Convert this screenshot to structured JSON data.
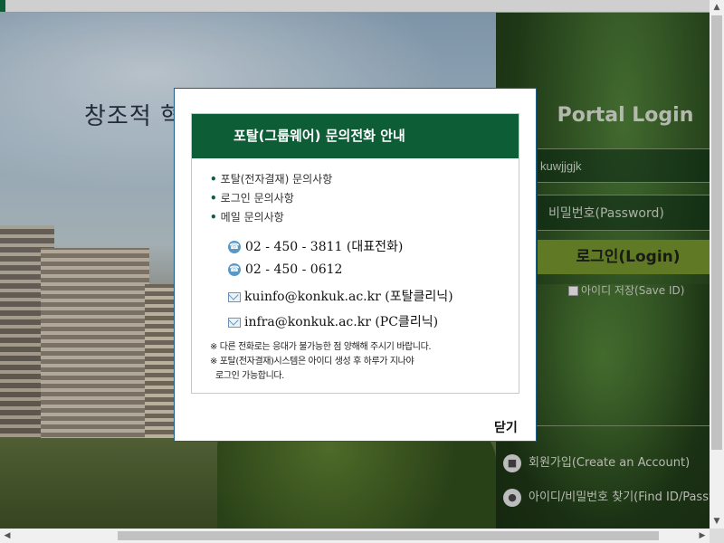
{
  "background": {
    "slogan": "창조적 혁"
  },
  "login": {
    "title": "Portal Login",
    "id_value": "kuwjjgjk",
    "password_placeholder": "비밀번호(Password)",
    "login_button": "로그인(Login)",
    "save_id_label": "아이디 저장(Save ID)",
    "signup_link": "회원가입(Create an Account)",
    "find_link": "아이디/비밀번호 찾기(Find ID/Password)"
  },
  "modal": {
    "title": "포탈(그룹웨어) 문의전화 안내",
    "items": [
      "포탈(전자결재) 문의사항",
      "로그인 문의사항",
      "메일 문의사항"
    ],
    "contacts": {
      "phone1": "02 - 450 - 3811 (대표전화)",
      "phone2": "02 - 450 - 0612",
      "email1": "kuinfo@konkuk.ac.kr (포탈클리닉)",
      "email2": "infra@konkuk.ac.kr (PC클리닉)"
    },
    "notes": {
      "line1": "※ 다른 전화로는 응대가 불가능한 점 양해해 주시기 바랍니다.",
      "line2": "※ 포탈(전자결재)시스템은 아이디 생성 후 하루가 지나야",
      "line3": "로그인 가능합니다."
    },
    "close_label": "닫기"
  },
  "icons": {
    "phone": "phone-icon",
    "mail": "mail-icon",
    "lock": "lock-icon",
    "user": "user-icon"
  },
  "colors": {
    "brand_green": "#0d5d37",
    "login_button": "#6e8a2a",
    "modal_border": "#1f5d8a"
  }
}
